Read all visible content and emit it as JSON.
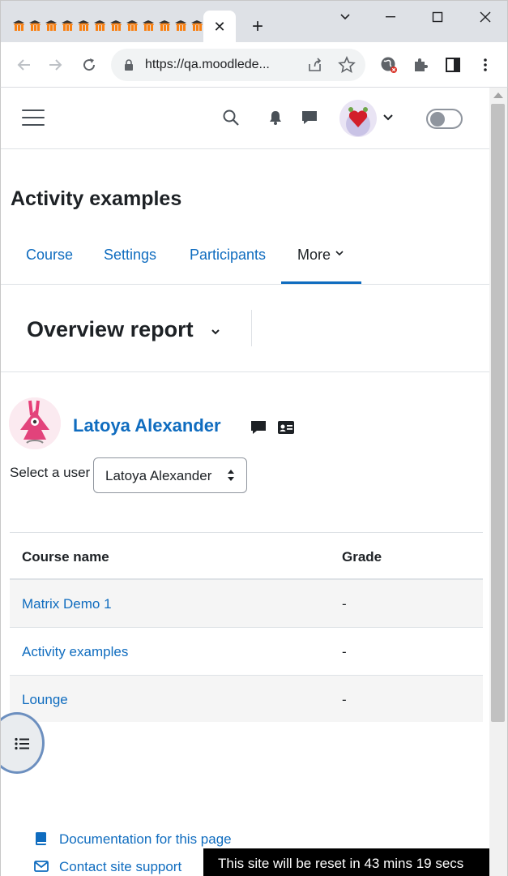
{
  "browser": {
    "tab_count_mini": 12,
    "active_tab_close": "✕",
    "new_tab": "+",
    "url": "https://qa.moodlede..."
  },
  "header": {
    "menu_icon": "hamburger-icon",
    "search_icon": "search-icon",
    "notifications_icon": "bell-icon",
    "messages_icon": "chat-icon"
  },
  "page": {
    "title": "Activity examples"
  },
  "secondary_nav": {
    "items": [
      "Course",
      "Settings",
      "Participants",
      "More"
    ]
  },
  "report": {
    "title": "Overview report"
  },
  "user": {
    "name": "Latoya Alexander",
    "select_label": "Select a user",
    "selected": "Latoya Alexander"
  },
  "table": {
    "headers": [
      "Course name",
      "Grade"
    ],
    "rows": [
      {
        "course": "Matrix Demo 1",
        "grade": "-"
      },
      {
        "course": "Activity examples",
        "grade": "-"
      },
      {
        "course": "Lounge",
        "grade": "-"
      }
    ]
  },
  "footer": {
    "docs_link": "Documentation for this page",
    "support_link": "Contact site support",
    "reset_notice": "This site will be reset in 43 mins 19 secs"
  },
  "colors": {
    "link": "#0f6cbf",
    "text": "#1d2125"
  }
}
